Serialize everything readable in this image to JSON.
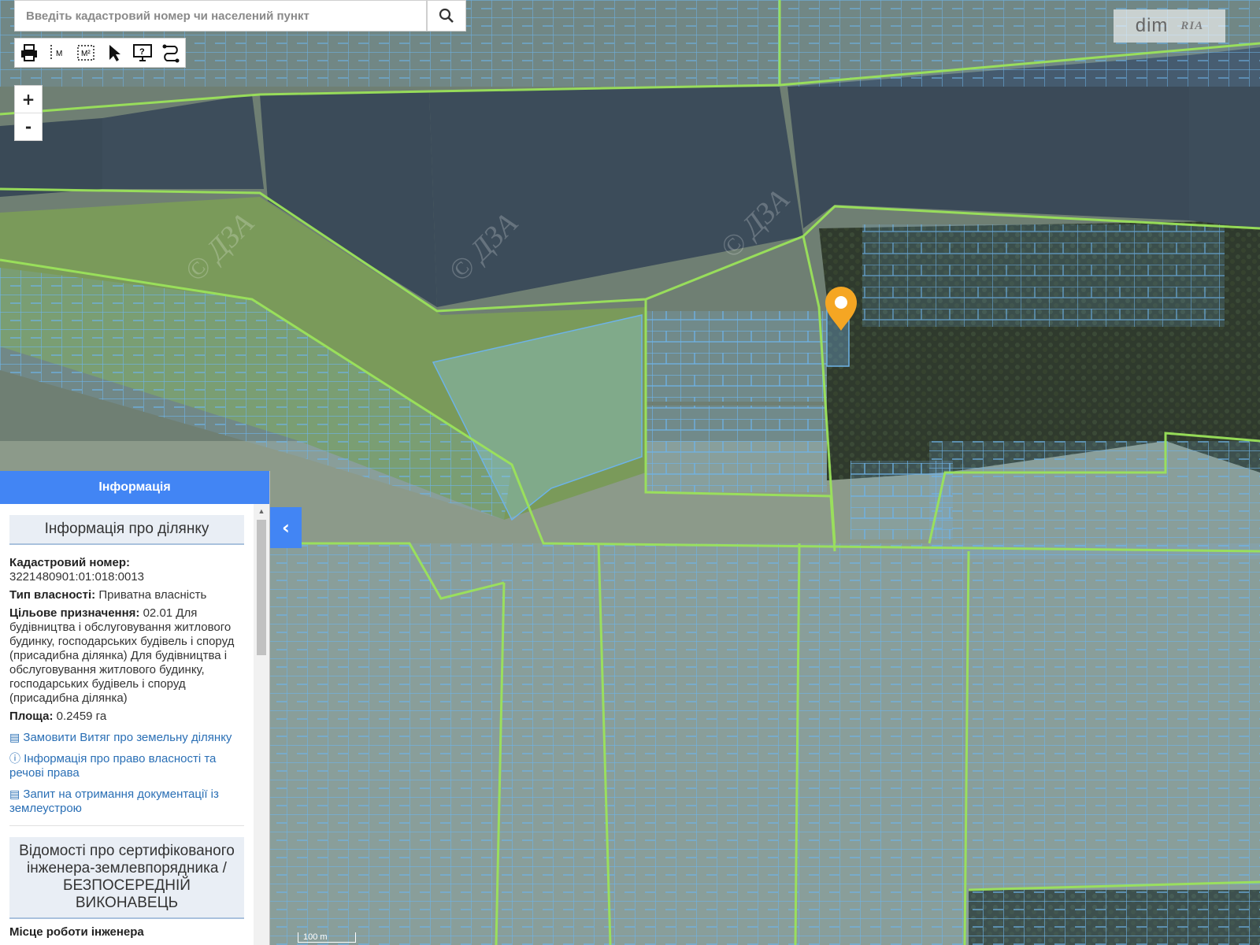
{
  "search": {
    "placeholder": "Введіть кадастровий номер чи населений пункт"
  },
  "toolbar": {
    "tools": [
      "print-icon",
      "measure-line-icon",
      "measure-area-icon",
      "select-pointer-icon",
      "info-monitor-icon",
      "route-icon"
    ],
    "m_label": "M",
    "m2_label": "M²"
  },
  "zoom": {
    "in_label": "+",
    "out_label": "-"
  },
  "logo": {
    "text": "dim",
    "sub": "RIA"
  },
  "watermarks": [
    "© ДЗА",
    "© ДЗА",
    "© ДЗА"
  ],
  "marker": {
    "icon": "location-pin-icon",
    "color": "#f5a623"
  },
  "colors": {
    "parcel": "#6db3e8",
    "boundary": "#9be35a",
    "panel_header": "#4285f4"
  },
  "panel": {
    "header": "Інформація",
    "section_title": "Інформація про ділянку",
    "cadastral_label": "Кадастровий номер:",
    "cadastral_value": "3221480901:01:018:0013",
    "ownership_label": "Тип власності:",
    "ownership_value": "Приватна власність",
    "purpose_label": "Цільове призначення:",
    "purpose_value": "02.01 Для будівництва і обслуговування житлового будинку, господарських будівель і споруд (присадибна ділянка) Для будівництва і обслуговування житлового будинку, господарських будівель і споруд (присадибна ділянка)",
    "area_label": "Площа:",
    "area_value": "0.2459 га",
    "link_extract": "Замовити Витяг про земельну ділянку",
    "link_rights": "Інформація про право власності та речові права",
    "link_docs": "Запит на отримання документації із землеустрою",
    "engineer_title": "Відомості про сертифікованого інженера-землевпорядника / БЕЗПОСЕРЕДНІЙ ВИКОНАВЕЦЬ",
    "engineer_work_label": "Місце роботи інженера"
  },
  "scale": {
    "label": "100 m"
  }
}
